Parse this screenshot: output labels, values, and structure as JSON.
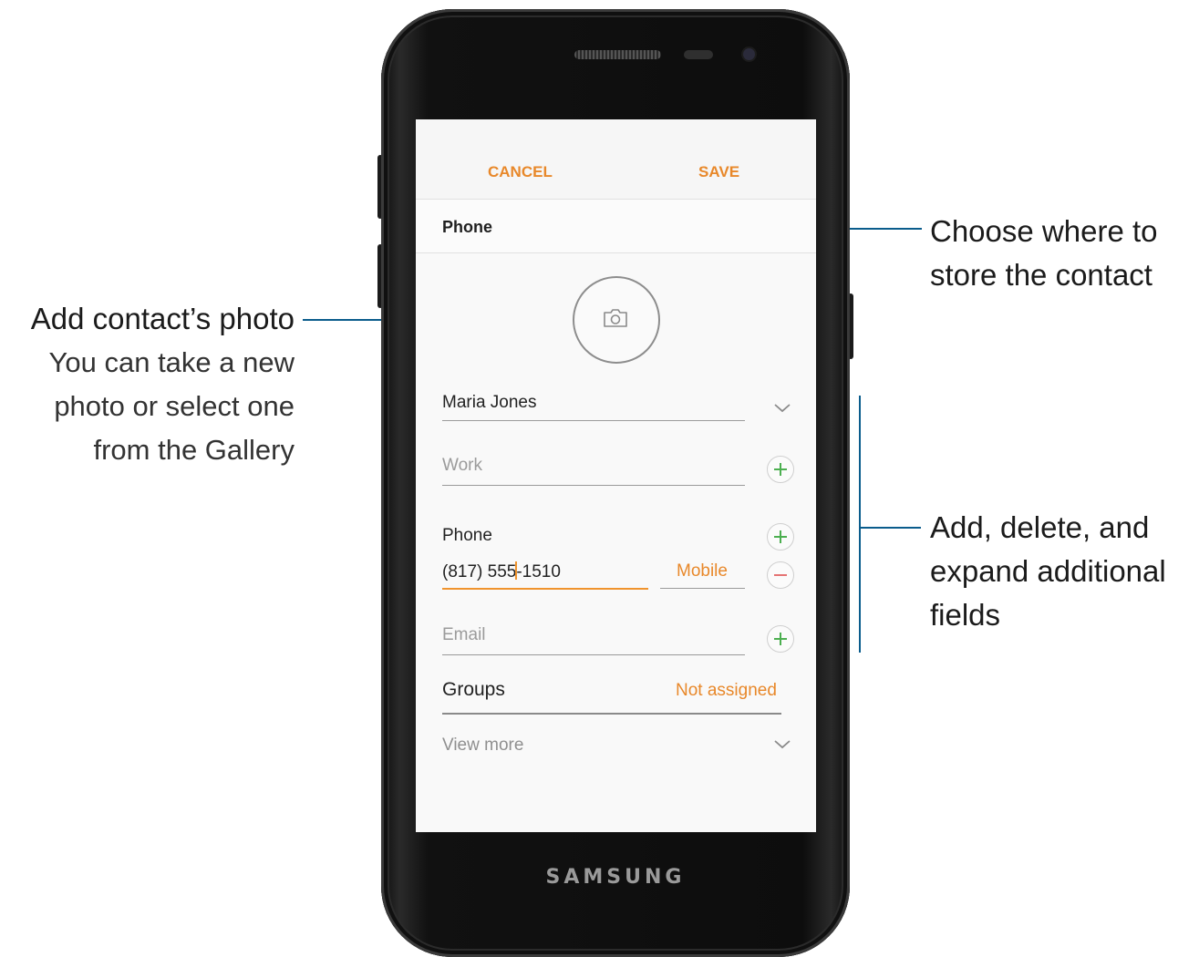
{
  "annotations": {
    "photo_title": "Add contact’s photo",
    "photo_desc_1": "You can take a new",
    "photo_desc_2": "photo or select one",
    "photo_desc_3": "from the Gallery",
    "storage_1": "Choose where to",
    "storage_2": "store the contact",
    "fields_1": "Add, delete, and",
    "fields_2": "expand additional",
    "fields_3": "fields"
  },
  "device": {
    "brand": "SAMSUNG"
  },
  "toolbar": {
    "cancel_label": "CANCEL",
    "save_label": "SAVE"
  },
  "storage": {
    "label": "Phone"
  },
  "form": {
    "name_value": "Maria Jones",
    "work_placeholder": "Work",
    "phone_label": "Phone",
    "phone_value_before_cursor": "(817) 555",
    "phone_value_after_cursor": "-1510",
    "phone_type": "Mobile",
    "email_placeholder": "Email",
    "groups_label": "Groups",
    "groups_value": "Not assigned",
    "view_more": "View more"
  },
  "colors": {
    "accent": "#e8882a",
    "add_green": "#4caf50",
    "remove_red": "#e57373",
    "leader_blue": "#0a5c8c"
  },
  "icons": [
    "camera-icon",
    "chevron-down-icon",
    "plus-icon",
    "minus-icon"
  ]
}
